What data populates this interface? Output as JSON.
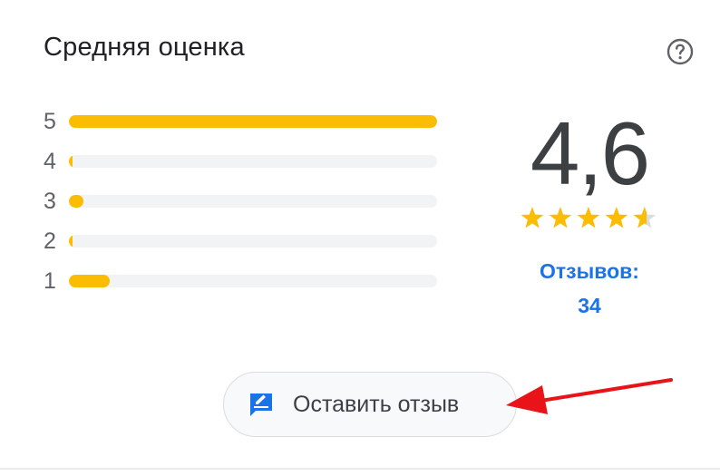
{
  "card": {
    "title": "Средняя оценка",
    "help_icon": "help-circle-icon"
  },
  "distribution": [
    {
      "label": "5",
      "fraction": 1.0
    },
    {
      "label": "4",
      "fraction": 0.01
    },
    {
      "label": "3",
      "fraction": 0.04
    },
    {
      "label": "2",
      "fraction": 0.01
    },
    {
      "label": "1",
      "fraction": 0.11
    }
  ],
  "summary": {
    "score": "4,6",
    "stars_value": 4.6,
    "stars_max": 5,
    "reviews_label": "Отзывов:",
    "reviews_count": "34"
  },
  "actions": {
    "write_review_label": "Оставить отзыв",
    "write_review_icon": "rate-review-icon"
  },
  "annotation": {
    "arrow_color": "#e8141a"
  },
  "colors": {
    "bar_fill": "#fbbc04",
    "bar_track": "#f1f3f4",
    "accent_blue": "#1a73e8",
    "star_empty": "#dadce0"
  }
}
